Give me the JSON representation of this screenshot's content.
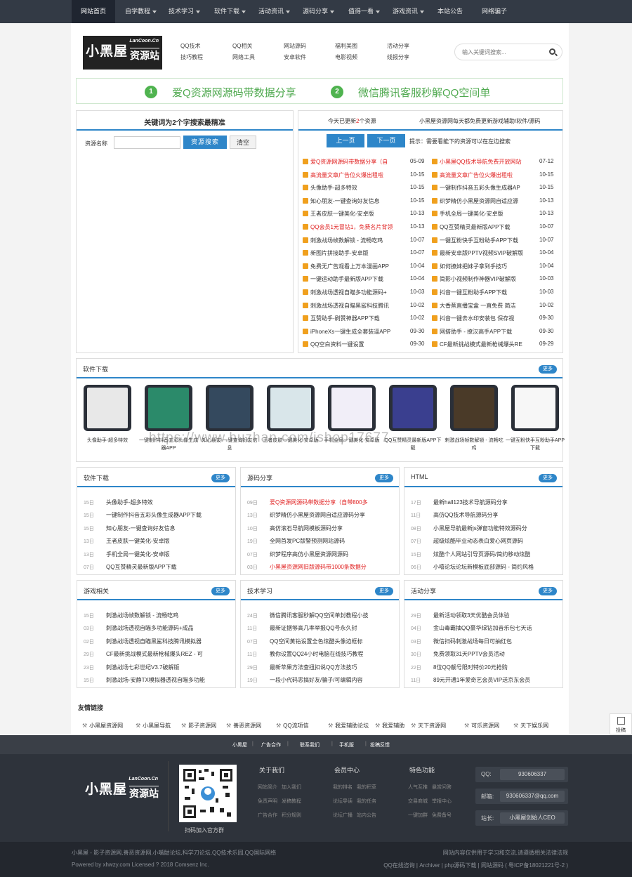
{
  "topnav": [
    {
      "label": "网站首页",
      "active": true,
      "caret": false
    },
    {
      "label": "自学教程",
      "caret": true
    },
    {
      "label": "技术学习",
      "caret": true
    },
    {
      "label": "软件下载",
      "caret": true
    },
    {
      "label": "活动资讯",
      "caret": true
    },
    {
      "label": "源码分享",
      "caret": true
    },
    {
      "label": "值得一看",
      "caret": true
    },
    {
      "label": "游戏资讯",
      "caret": true
    },
    {
      "label": "本站公告",
      "caret": false
    },
    {
      "label": "网络骗子",
      "caret": false
    }
  ],
  "logo": {
    "big": "小黑屋",
    "cn": "LanCoon.Cn",
    "small": "资源站"
  },
  "header_links": [
    [
      "QQ技术",
      "技巧教程"
    ],
    [
      "QQ相关",
      "网络工具"
    ],
    [
      "网站源码",
      "安卓软件"
    ],
    [
      "福利美图",
      "电影视频"
    ],
    [
      "活动分享",
      "线报分享"
    ]
  ],
  "search": {
    "placeholder": "输入关键词搜索..."
  },
  "banner": [
    {
      "num": "1",
      "text": "爱Q资源网源码带数据分享"
    },
    {
      "num": "2",
      "text": "微信腾讯客服秒解QQ空间单"
    }
  ],
  "left_search": {
    "title": "关键词为2个字搜索最精准",
    "label": "资源名称",
    "button": "资源搜索",
    "clear": "清空"
  },
  "updates": {
    "today": "今天已更新",
    "count": "2",
    "unit": "个资源",
    "slogan": "小黑屋资源网每天都免费更新游戏辅助/软件/源码",
    "prev": "上一页",
    "next": "下一页",
    "tip": "提示：需要看能下的资源可以在左边搜索",
    "accent": "#e02020"
  },
  "updates_rows": [
    [
      {
        "t": "爱Q资源网源码带数据分享（自",
        "d": "05-09",
        "red": true
      },
      {
        "t": "小黑屋QQ技术导航免费开放网站",
        "d": "07-12",
        "red": true
      }
    ],
    [
      {
        "t": "高流量文章广告位火爆出租啦",
        "d": "10-15",
        "red": true
      },
      {
        "t": "高流量文章广告位火爆出租啦",
        "d": "10-15",
        "red": true
      }
    ],
    [
      {
        "t": "头像助手-超多特效",
        "d": "10-15"
      },
      {
        "t": "一键制作抖音五彩头像生成器AP",
        "d": "10-15"
      }
    ],
    [
      {
        "t": "知心朋友-一键查询好友信息",
        "d": "10-15"
      },
      {
        "t": "织梦精仿小黑屋资源网自适应源",
        "d": "10-13"
      }
    ],
    [
      {
        "t": "王者皮肤一键美化-安卓版",
        "d": "10-13"
      },
      {
        "t": "手机全局一键美化-安卓版",
        "d": "10-13"
      }
    ],
    [
      {
        "t": "QQ会员1元冒钻1，免费名片背领",
        "d": "10-13",
        "red": true
      },
      {
        "t": "QQ互赞精灵最新版APP下载",
        "d": "10-07"
      }
    ],
    [
      {
        "t": "刺激战场帧数解锁 - 流畅吃鸡",
        "d": "10-07"
      },
      {
        "t": "一键互粉快手互粉助手APP下载",
        "d": "10-07"
      }
    ],
    [
      {
        "t": "新图片拼接助手-安卓版",
        "d": "10-07"
      },
      {
        "t": "最新安卓版PPTV视频SVIP破解版",
        "d": "10-04"
      }
    ],
    [
      {
        "t": "免费无广告观看上万本漫画APP",
        "d": "10-04"
      },
      {
        "t": "如何撩妹把妹子拿到手技巧",
        "d": "10-04"
      }
    ],
    [
      {
        "t": "一键运动助手最新版APP下载",
        "d": "10-04"
      },
      {
        "t": "简影小视频制作神器VIP破解版",
        "d": "10-03"
      }
    ],
    [
      {
        "t": "刺激战场透视自瞄多功能源码+",
        "d": "10-03"
      },
      {
        "t": "抖音一键互粉助手APP下载",
        "d": "10-03"
      }
    ],
    [
      {
        "t": "刺激战场透视自瞄黑鲨科技腾讯",
        "d": "10-02"
      },
      {
        "t": "大香蕉直播宝盒 一直免费 简洁",
        "d": "10-02"
      }
    ],
    [
      {
        "t": "互赞助手-刷赞神器APP下载",
        "d": "10-02"
      },
      {
        "t": "抖音一键去水印安装包 保存视",
        "d": "09-30"
      }
    ],
    [
      {
        "t": "iPhoneXs一键生成全套装逼APP",
        "d": "09-30"
      },
      {
        "t": "网搭助手 - 撩汉高手APP下载",
        "d": "09-30"
      }
    ],
    [
      {
        "t": "QQ空白资料一键设置",
        "d": "09-30"
      },
      {
        "t": "CF最新挑战模式最新枪械爆头RE",
        "d": "09-29"
      }
    ]
  ],
  "software_section": {
    "title": "软件下载",
    "more": "更多"
  },
  "software_items": [
    {
      "caption": "头像助手-超多特效",
      "color": "#e8e8e8"
    },
    {
      "caption": "一键制作抖音五彩头像生成器APP",
      "color": "#2b8a6a"
    },
    {
      "caption": "知心朋友-一键查询好友信息",
      "color": "#34495e"
    },
    {
      "caption": "王者皮肤一键美化-安卓版",
      "color": "#d9e6ea"
    },
    {
      "caption": "手机全局一键美化-安卓版",
      "color": "#f1eef8"
    },
    {
      "caption": "QQ互赞精灵最新版APP下载",
      "color": "#3a3f8f"
    },
    {
      "caption": "刺激战场帧数解锁 - 流畅吃鸡",
      "color": "#4a3a28"
    },
    {
      "caption": "一键互粉快手互粉助手APP下载",
      "color": "#f7f7f7"
    }
  ],
  "watermark": "https://www.huzhan.com/ishop17677",
  "lists": [
    {
      "title": "软件下载",
      "more": "更多",
      "items": [
        [
          "15日",
          "头像助手-超多特效",
          false
        ],
        [
          "15日",
          "一键制作抖音五彩头像生成器APP下载",
          false
        ],
        [
          "15日",
          "知心朋友-一键查询好友信息",
          false
        ],
        [
          "13日",
          "王者皮肤一键美化-安卓版",
          false
        ],
        [
          "13日",
          "手机全局一键美化-安卓版",
          false
        ],
        [
          "07日",
          "QQ互赞精灵最新版APP下载",
          false
        ]
      ]
    },
    {
      "title": "源码分享",
      "more": "更多",
      "items": [
        [
          "09日",
          "爱Q资源网源码带数据分享（自带800多",
          true
        ],
        [
          "13日",
          "织梦精仿小黑屋资源网自适应源码分享",
          false
        ],
        [
          "10日",
          "高仿滚石导航网模板源码分享",
          false
        ],
        [
          "19日",
          "全网首发PC版警预测网站源码",
          false
        ],
        [
          "07日",
          "织梦程序高仿小黑屋资源网源码",
          false
        ],
        [
          "03日",
          "小黑屋资源网旧版源码带1000条数据分",
          true
        ]
      ]
    },
    {
      "title": "HTML",
      "more": "更多",
      "items": [
        [
          "17日",
          "最新hall123技术导航源码分享",
          false
        ],
        [
          "11日",
          "高仿QQ技术导航源码分享",
          false
        ],
        [
          "08日",
          "小黑屋导航最新js弹窗功能特效源码分",
          false
        ],
        [
          "07日",
          "超级炫酷毕业动态表白爱心网页源码",
          false
        ],
        [
          "15日",
          "炫酷个人网站引导页源码/简约移动炫酷",
          false
        ],
        [
          "06日",
          "小嘻论坛论坛新模板底部源码 - 简约风格",
          false
        ]
      ]
    },
    {
      "title": "游戏相关",
      "more": "更多",
      "items": [
        [
          "15日",
          "刺激战场帧数解锁 - 流畅吃鸡",
          false
        ],
        [
          "03日",
          "刺激战场透视自瞄多功能源码+成品",
          false
        ],
        [
          "02日",
          "刺激战场透视自瞄黑鲨科技腾讯模拟器",
          false
        ],
        [
          "29日",
          "CF最新挑战模式最新枪械爆头REZ - 可",
          false
        ],
        [
          "23日",
          "刺激战场七彩世纪V3.7破解版",
          false
        ],
        [
          "15日",
          "刺激战场-安静TX模拟器透视自瞄多功能",
          false
        ]
      ]
    },
    {
      "title": "技术学习",
      "more": "更多",
      "items": [
        [
          "24日",
          "微信腾讯客服秒解QQ空间单封教程小技",
          false
        ],
        [
          "11日",
          "最新证据够高几率举报QQ号永久封",
          false
        ],
        [
          "07日",
          "QQ空间黄钻设置全色炫酷头像边框标",
          false
        ],
        [
          "11日",
          "教你设置QQ24小时电脑在线技巧教程",
          false
        ],
        [
          "29日",
          "最新苹果方法查扭扣说QQ方法技巧",
          false
        ],
        [
          "19日",
          "一段小代码恶搞好友/骗子/可编辑内容",
          false
        ]
      ]
    },
    {
      "title": "活动分享",
      "more": "更多",
      "items": [
        [
          "29日",
          "最新活动领取3天优酷会员体验",
          false
        ],
        [
          "04日",
          "金山毒霸抽QQ豪华绿钻加音乐包七天话",
          false
        ],
        [
          "03日",
          "微信扫码刺激战场每日可抽红包",
          false
        ],
        [
          "30日",
          "免费领取31天PPTV会员活动",
          false
        ],
        [
          "22日",
          "8位QQ靓号限时特价20元抢购",
          false
        ],
        [
          "11日",
          "89元开通1年爱奇艺会员VIP送京东会员",
          false
        ]
      ]
    }
  ],
  "friend_links": {
    "title": "友情链接",
    "items": [
      "小黑屋资源网",
      "小黑屋导航",
      "影子资源网",
      "善恶资源网",
      "QQ流项信",
      "我爱辅助论坛",
      "我爱辅助",
      "天下资源网",
      "可乐资源网",
      "天下娱乐网"
    ]
  },
  "bottom_bar": [
    "小黑屋",
    "广告合作",
    "联系我们",
    "手机版",
    "投稿反馈"
  ],
  "footer": {
    "qr_caption": "扫码加入官方群",
    "cols": [
      {
        "title": "关于我们",
        "links": [
          "网站简介",
          "加入我们",
          "免责声明",
          "发稿教程",
          "广告合作",
          "积分规则"
        ]
      },
      {
        "title": "会员中心",
        "links": [
          "我的排名",
          "我的积草",
          "论坛导读",
          "我的任务",
          "论坛广播",
          "站内公告"
        ]
      },
      {
        "title": "特色功能",
        "links": [
          "人气互推",
          "悬赏问答",
          "交易商城",
          "举报中心",
          "一键加群",
          "免费备号"
        ]
      }
    ],
    "contacts": [
      {
        "k": "QQ:",
        "v": "930606337"
      },
      {
        "k": "邮箱:",
        "v": "930606337@qq.com"
      },
      {
        "k": "站长:",
        "v": "小黑屋创始人CEO"
      }
    ]
  },
  "footer2": {
    "left1": "小黑屋 - 影子资源网,善恶资源网,小嘴骷论坛,科学刀论坛,QQ技术乐园,QQ国际网络",
    "left2": "Powered by xhwzy.com Licensed ? 2018 Comsenz Inc.",
    "right1": "网站内容仅供用于学习和交流,请遵循相关法律法规",
    "right2": "QQ在线咨询 | Archiver | php源码下载 | 网站源码 ( 粤ICP备18021221号-2 )"
  },
  "feedback": "投稿"
}
